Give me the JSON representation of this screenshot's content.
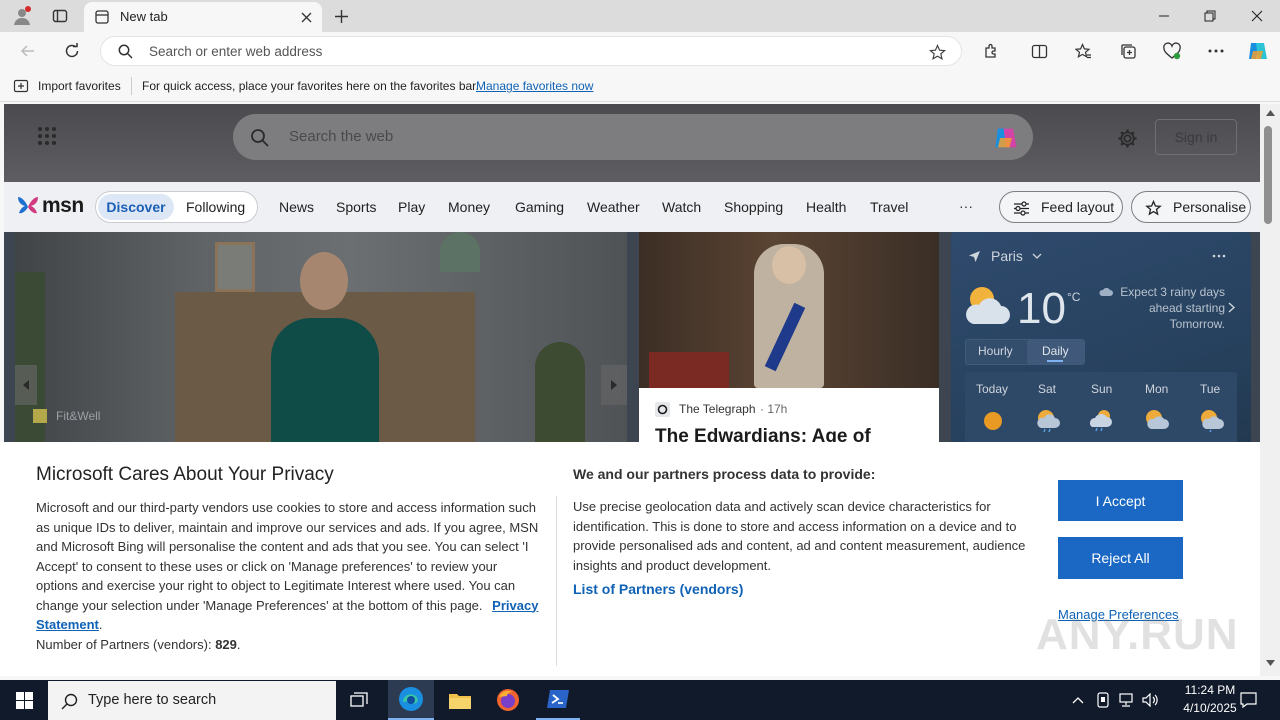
{
  "browser": {
    "tab_title": "New tab",
    "address_placeholder": "Search or enter web address",
    "fav_import": "Import favorites",
    "fav_hint": "For quick access, place your favorites here on the favorites bar.",
    "fav_link": "Manage favorites now"
  },
  "msn": {
    "search_placeholder": "Search the web",
    "sign_in": "Sign in",
    "logo": "msn",
    "tabs": [
      "Discover",
      "Following"
    ],
    "nav": [
      "News",
      "Sports",
      "Play",
      "Money",
      "Gaming",
      "Weather",
      "Watch",
      "Shopping",
      "Health",
      "Travel"
    ],
    "more": "···",
    "feed_layout": "Feed layout",
    "personalise": "Personalise",
    "hero_source": "Fit&Well",
    "card_source": "The Telegraph",
    "card_time": "· 17h",
    "card_title": "The Edwardians: Age of"
  },
  "weather": {
    "location": "Paris",
    "temp": "10",
    "unit": "°C",
    "note": "Expect 3 rainy days ahead starting Tomorrow.",
    "tabs": [
      "Hourly",
      "Daily"
    ],
    "days": [
      "Today",
      "Sat",
      "Sun",
      "Mon",
      "Tue"
    ]
  },
  "privacy": {
    "title": "Microsoft Cares About Your Privacy",
    "body": "Microsoft and our third-party vendors use cookies to store and access information such as unique IDs to deliver, maintain and improve our services and ads. If you agree, MSN and Microsoft Bing will personalise the content and ads that you see. You can select 'I Accept' to consent to these uses or click on 'Manage preferences' to review your options and exercise your right to object to Legitimate Interest where used.  You can change your selection under 'Manage Preferences' at the bottom of this page.",
    "privacy_link": "Privacy Statement",
    "partners_label": "Number of Partners (vendors):",
    "partners_count": "829",
    "right_title": "We and our partners process data to provide:",
    "right_body": "Use precise geolocation data and actively scan device characteristics for identification. This is done to store and access information on a device and to provide personalised ads and content, ad and content measurement, audience insights and product development.",
    "partners_link": "List of Partners (vendors)",
    "accept": "I Accept",
    "reject": "Reject All",
    "manage": "Manage Preferences"
  },
  "taskbar": {
    "search_placeholder": "Type here to search",
    "time": "11:24 PM",
    "date": "4/10/2025"
  },
  "watermark": "ANY.RUN",
  "colors": {
    "accent": "#1b68c4",
    "taskbar": "#101a2a",
    "link": "#0f62b5"
  }
}
